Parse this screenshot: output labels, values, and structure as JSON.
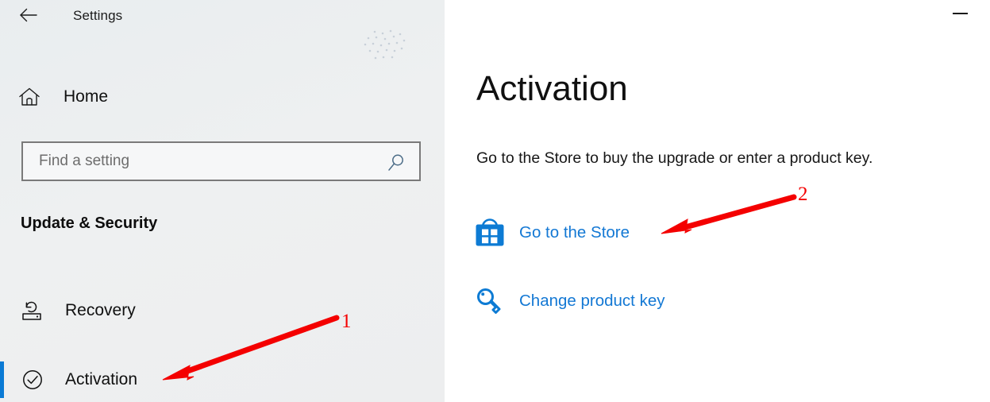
{
  "window": {
    "title": "Settings",
    "back_icon": "back-arrow-icon",
    "minimize_label": "Minimize"
  },
  "sidebar": {
    "home": {
      "label": "Home",
      "icon": "home-icon"
    },
    "search": {
      "placeholder": "Find a setting",
      "value": "",
      "icon": "search-icon"
    },
    "section_title": "Update & Security",
    "items": [
      {
        "label": "Recovery",
        "icon": "recovery-icon",
        "selected": false
      },
      {
        "label": "Activation",
        "icon": "check-circle-icon",
        "selected": true
      }
    ]
  },
  "main": {
    "heading": "Activation",
    "description": "Go to the Store to buy the upgrade or enter a product key.",
    "links": [
      {
        "label": "Go to the Store",
        "icon": "microsoft-store-icon"
      },
      {
        "label": "Change product key",
        "icon": "key-icon"
      }
    ]
  },
  "annotations": [
    {
      "number": "1",
      "target": "Activation"
    },
    {
      "number": "2",
      "target": "Go to the Store"
    }
  ],
  "colors": {
    "accent_blue": "#0a7ad5",
    "link_blue": "#1378d4",
    "store_blue": "#0d7bd4",
    "annotation_red": "#f40000",
    "sidebar_bg": "#eceef0"
  }
}
